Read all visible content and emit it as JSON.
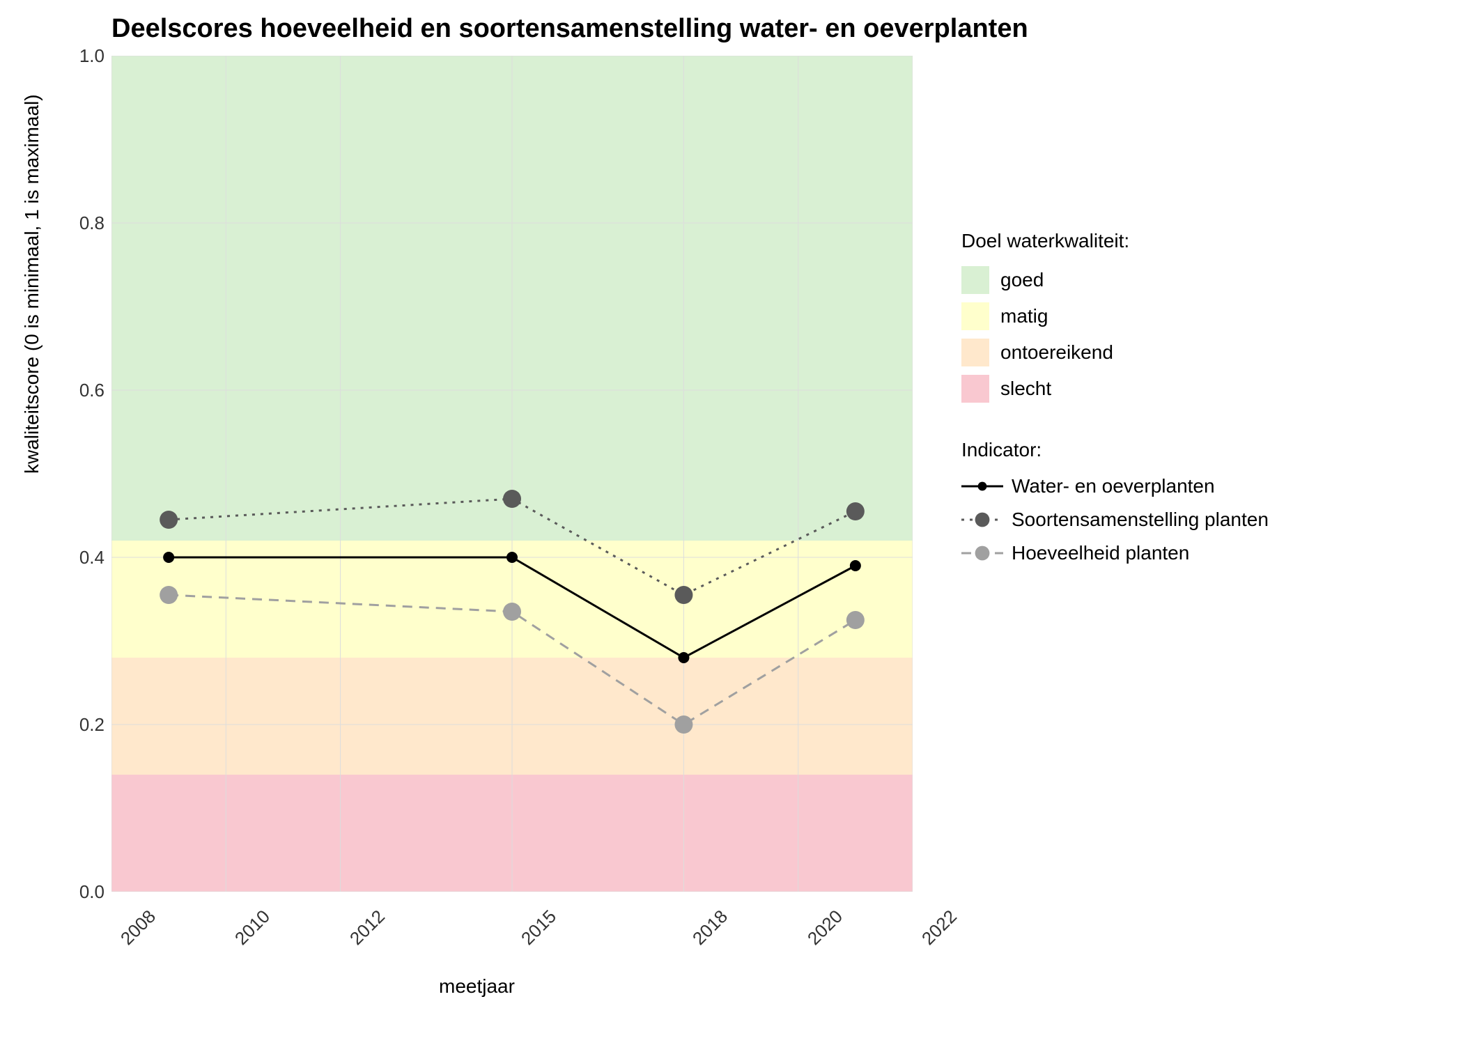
{
  "chart_data": {
    "type": "line",
    "title": "Deelscores hoeveelheid en soortensamenstelling water- en oeverplanten",
    "xlabel": "meetjaar",
    "ylabel": "kwaliteitscore (0 is minimaal, 1 is maximaal)",
    "x": [
      2009,
      2015,
      2018,
      2021
    ],
    "x_ticks": [
      2008,
      2010,
      2012,
      2015,
      2018,
      2020,
      2022
    ],
    "y_ticks": [
      0.0,
      0.2,
      0.4,
      0.6,
      0.8,
      1.0
    ],
    "xlim": [
      2008,
      2022
    ],
    "ylim": [
      0,
      1
    ],
    "series": [
      {
        "name": "Water- en oeverplanten",
        "values": [
          0.4,
          0.4,
          0.28,
          0.39
        ],
        "color": "#000000",
        "dash": "solid",
        "point_color": "#000000",
        "point_size": 8
      },
      {
        "name": "Soortensamenstelling planten",
        "values": [
          0.445,
          0.47,
          0.355,
          0.455
        ],
        "color": "#5a5a5a",
        "dash": "dotted",
        "point_color": "#5a5a5a",
        "point_size": 13
      },
      {
        "name": "Hoeveelheid planten",
        "values": [
          0.355,
          0.335,
          0.2,
          0.325
        ],
        "color": "#a0a0a0",
        "dash": "dashed",
        "point_color": "#a0a0a0",
        "point_size": 13
      }
    ],
    "bands": [
      {
        "name": "goed",
        "from": 0.42,
        "to": 1.0,
        "color": "#d9f0d3"
      },
      {
        "name": "matig",
        "from": 0.28,
        "to": 0.42,
        "color": "#ffffcc"
      },
      {
        "name": "ontoereikend",
        "from": 0.14,
        "to": 0.28,
        "color": "#ffe8cc"
      },
      {
        "name": "slecht",
        "from": 0.0,
        "to": 0.14,
        "color": "#f9c8d0"
      }
    ],
    "legend_bands_title": "Doel waterkwaliteit:",
    "legend_series_title": "Indicator:"
  }
}
